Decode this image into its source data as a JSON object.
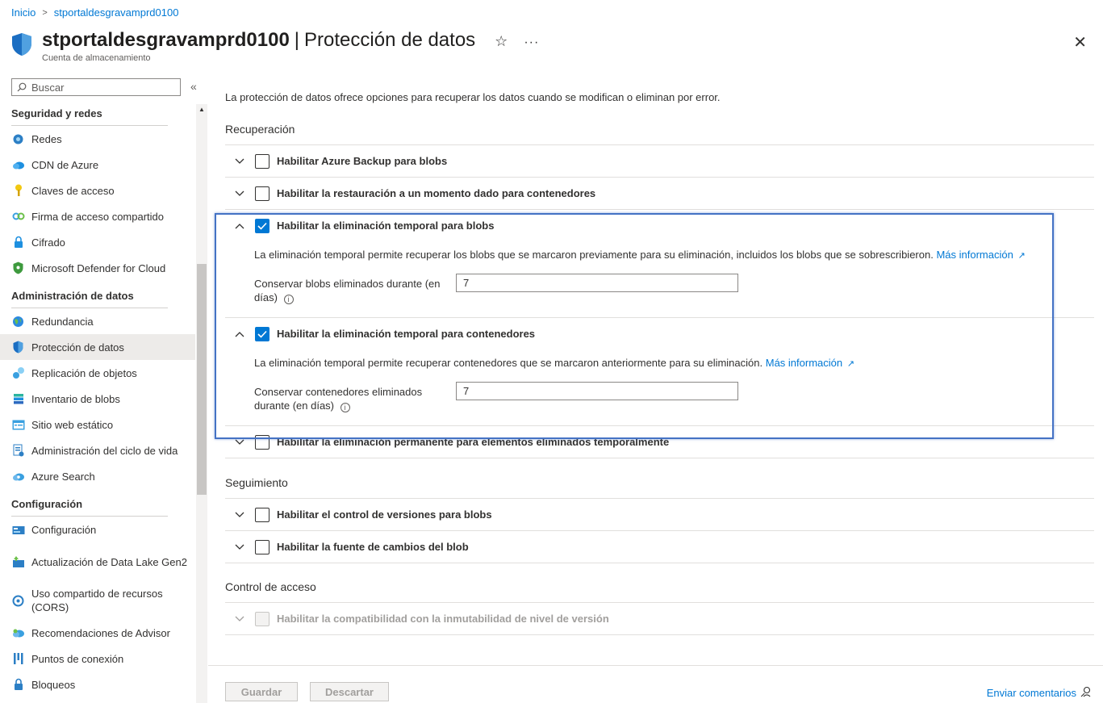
{
  "breadcrumb": {
    "home": "Inicio",
    "resource": "stportaldesgravamprd0100"
  },
  "header": {
    "title": "stportaldesgravamprd0100",
    "separator": "|",
    "page": "Protección de datos",
    "subtitle": "Cuenta de almacenamiento"
  },
  "sidebar": {
    "search_placeholder": "Buscar",
    "sections": [
      {
        "title": "Seguridad y redes",
        "items": [
          {
            "label": "Redes",
            "icon": "networking-icon"
          },
          {
            "label": "CDN de Azure",
            "icon": "cloud-icon"
          },
          {
            "label": "Claves de acceso",
            "icon": "key-icon"
          },
          {
            "label": "Firma de acceso compartido",
            "icon": "link-icon"
          },
          {
            "label": "Cifrado",
            "icon": "lock-icon"
          },
          {
            "label": "Microsoft Defender for Cloud",
            "icon": "shield-icon"
          }
        ]
      },
      {
        "title": "Administración de datos",
        "items": [
          {
            "label": "Redundancia",
            "icon": "globe-icon"
          },
          {
            "label": "Protección de datos",
            "icon": "shield-data-icon"
          },
          {
            "label": "Replicación de objetos",
            "icon": "replication-icon"
          },
          {
            "label": "Inventario de blobs",
            "icon": "inventory-icon"
          },
          {
            "label": "Sitio web estático",
            "icon": "website-icon"
          },
          {
            "label": "Administración del ciclo de vida",
            "icon": "lifecycle-icon"
          },
          {
            "label": "Azure Search",
            "icon": "search-cloud-icon"
          }
        ]
      },
      {
        "title": "Configuración",
        "items": [
          {
            "label": "Configuración",
            "icon": "config-icon"
          },
          {
            "label": "Actualización de Data Lake Gen2",
            "icon": "upgrade-icon"
          },
          {
            "label": "Uso compartido de recursos (CORS)",
            "icon": "cors-icon"
          },
          {
            "label": "Recomendaciones de Advisor",
            "icon": "advisor-icon"
          },
          {
            "label": "Puntos de conexión",
            "icon": "endpoints-icon"
          },
          {
            "label": "Bloqueos",
            "icon": "locks-icon"
          }
        ]
      }
    ]
  },
  "main": {
    "intro": "La protección de datos ofrece opciones para recuperar los datos cuando se modifican o eliminan por error.",
    "recovery": {
      "title": "Recuperación",
      "backup_label": "Habilitar Azure Backup para blobs",
      "restore_label": "Habilitar la restauración a un momento dado para contenedores",
      "soft_blob_label": "Habilitar la eliminación temporal para blobs",
      "soft_blob_desc": "La eliminación temporal permite recuperar los blobs que se marcaron previamente para su eliminación, incluidos los blobs que se sobrescribieron.",
      "soft_blob_link": "Más información",
      "soft_blob_field_label": "Conservar blobs eliminados durante (en días)",
      "soft_blob_value": "7",
      "soft_container_label": "Habilitar la eliminación temporal para contenedores",
      "soft_container_desc": "La eliminación temporal permite recuperar contenedores que se marcaron anteriormente para su eliminación.",
      "soft_container_link": "Más información",
      "soft_container_field_label": "Conservar contenedores eliminados durante (en días)",
      "soft_container_value": "7",
      "permanent_label": "Habilitar la eliminación permanente para elementos eliminados temporalmente"
    },
    "tracking": {
      "title": "Seguimiento",
      "versioning_label": "Habilitar el control de versiones para blobs",
      "changefeed_label": "Habilitar la fuente de cambios del blob"
    },
    "access": {
      "title": "Control de acceso",
      "immutability_label": "Habilitar la compatibilidad con la inmutabilidad de nivel de versión"
    }
  },
  "footer": {
    "save_label": "Guardar",
    "discard_label": "Descartar",
    "feedback_label": "Enviar comentarios"
  },
  "colors": {
    "accent": "#0078d4",
    "highlight": "#4472c4"
  }
}
